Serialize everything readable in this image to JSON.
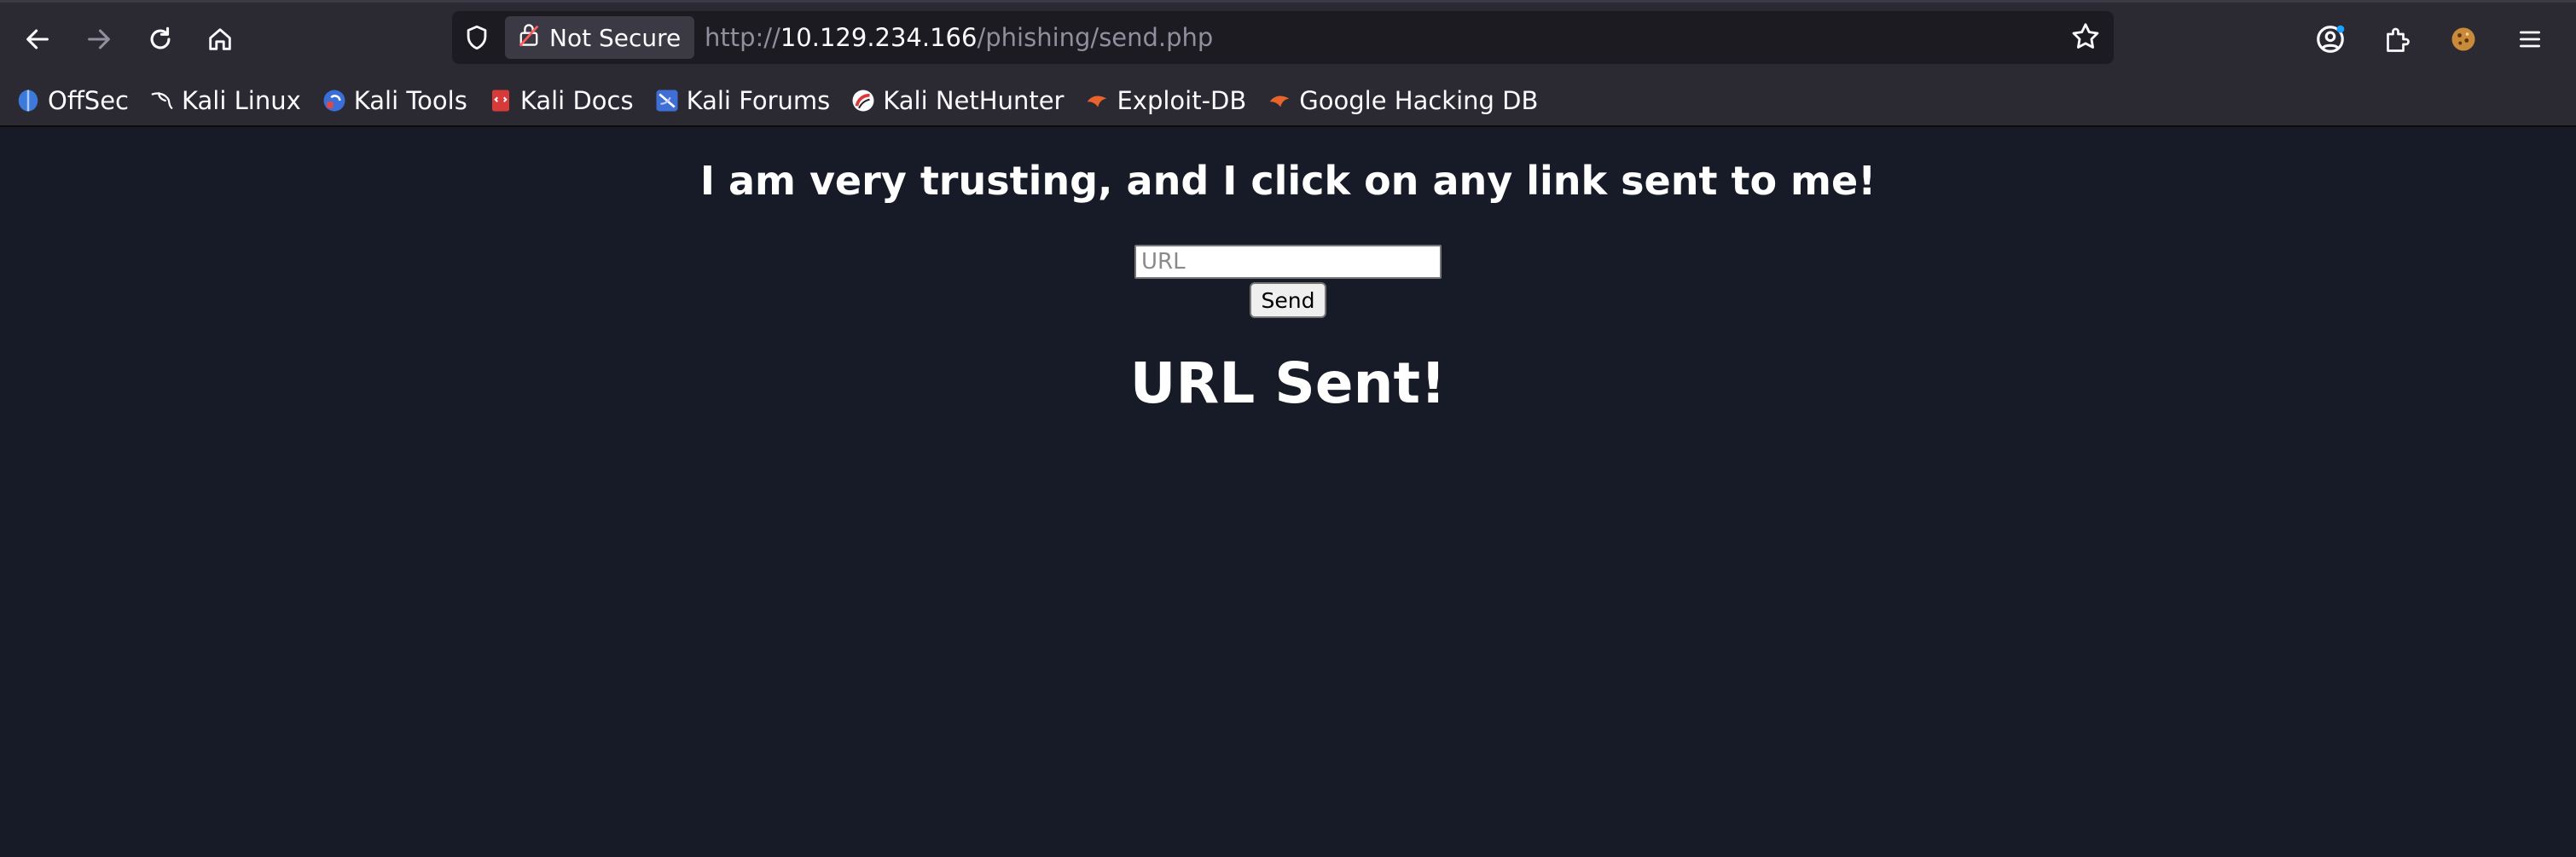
{
  "browser": {
    "security_label": "Not Secure",
    "url": {
      "scheme": "http://",
      "host": "10.129.234.166",
      "path": "/phishing/send.php"
    },
    "bookmarks": [
      {
        "label": "OffSec",
        "icon": "offsec-icon"
      },
      {
        "label": "Kali Linux",
        "icon": "kali-dragon-icon"
      },
      {
        "label": "Kali Tools",
        "icon": "kali-tools-icon"
      },
      {
        "label": "Kali Docs",
        "icon": "kali-docs-icon"
      },
      {
        "label": "Kali Forums",
        "icon": "kali-forums-icon"
      },
      {
        "label": "Kali NetHunter",
        "icon": "nethunter-icon"
      },
      {
        "label": "Exploit-DB",
        "icon": "exploit-db-icon"
      },
      {
        "label": "Google Hacking DB",
        "icon": "ghdb-icon"
      }
    ]
  },
  "page": {
    "heading": "I am very trusting, and I click on any link sent to me!",
    "url_input_placeholder": "URL",
    "url_input_value": "",
    "send_button_label": "Send",
    "status_message": "URL Sent!"
  },
  "colors": {
    "page_background": "#161b27",
    "chrome_background": "#2b2a33",
    "urlbar_background": "#1c1b22"
  }
}
